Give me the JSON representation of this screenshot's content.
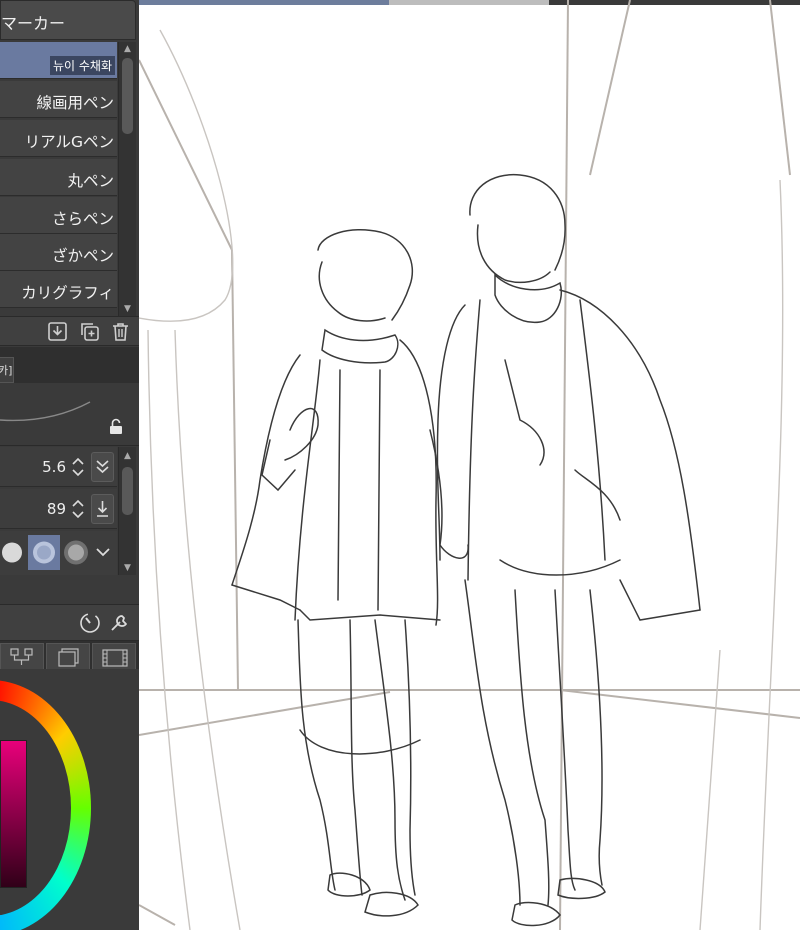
{
  "panel": {
    "title": "マーカー",
    "brushes": [
      {
        "label": "뉴이 수채화",
        "selected": true
      },
      {
        "label": "線画用ペン",
        "selected": false
      },
      {
        "label": "リアルGペン",
        "selected": false
      },
      {
        "label": "丸ペン",
        "selected": false
      },
      {
        "label": "さらペン",
        "selected": false
      },
      {
        "label": "ざかペン",
        "selected": false
      },
      {
        "label": "カリグラフィ",
        "selected": false
      }
    ],
    "tab_label": "카]",
    "props": {
      "brush_size": "5.6",
      "density": "89"
    },
    "icons": {
      "save": "download-icon",
      "duplicate": "duplicate-icon",
      "delete": "trash-icon",
      "lock": "lock-icon",
      "timer": "dial-icon",
      "settings": "wrench-icon"
    }
  },
  "colors": {
    "panel_bg": "#3a3a3a",
    "selection": "#6a7aa0",
    "accent_bar": "#6d7d9c"
  }
}
